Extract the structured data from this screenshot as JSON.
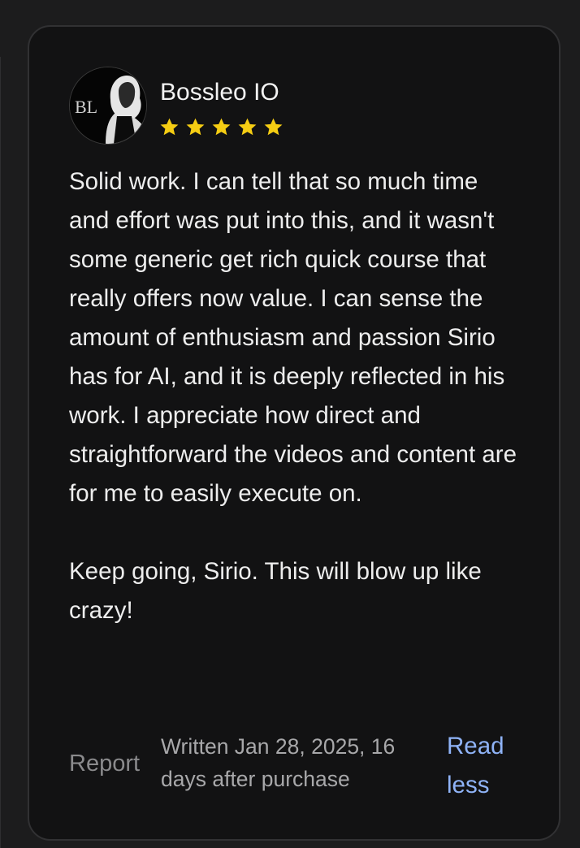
{
  "review": {
    "reviewer_name": "Bossleo IO",
    "avatar_initials": "BL",
    "rating": 5,
    "max_rating": 5,
    "star_color": "#f5cd13",
    "text": "Solid work. I can tell that so much time and effort was put into this, and it wasn't some generic get rich quick course that really offers now value. I can sense the amount of enthusiasm and passion Sirio has for AI, and it is deeply reflected in his work. I appreciate how direct and straightforward the videos and content are for me to easily execute on.\n\nKeep going, Sirio. This will blow up like crazy!",
    "report_label": "Report",
    "meta": "Written Jan 28, 2025, 16 days after purchase",
    "read_less_label": "Read less",
    "link_color": "#8fb3f7"
  }
}
